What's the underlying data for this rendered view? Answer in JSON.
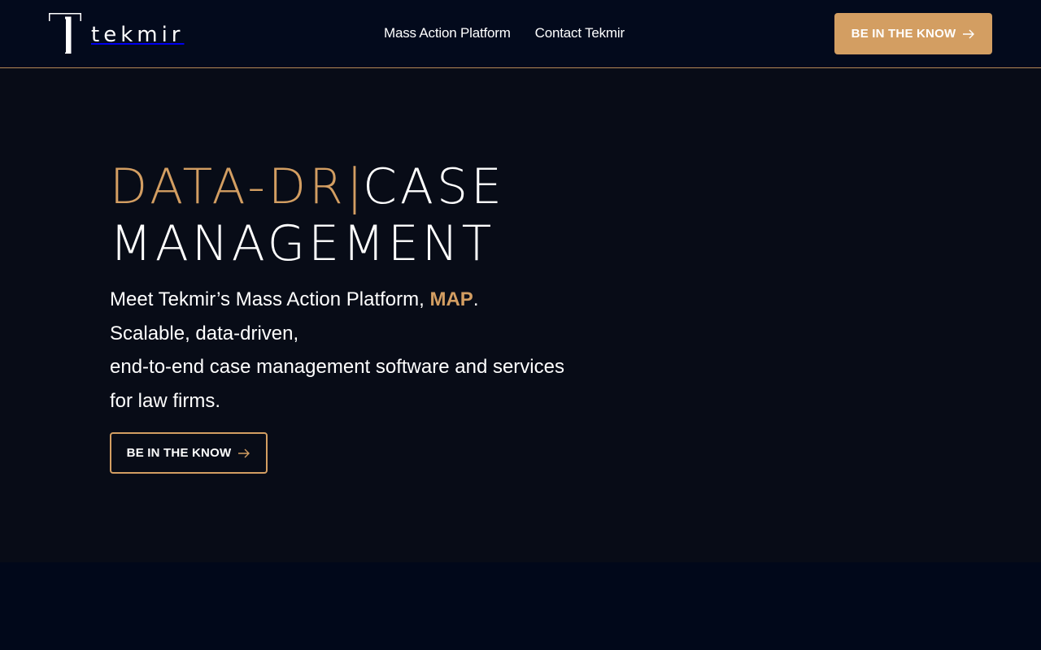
{
  "brand": {
    "logo_text": "tekmir",
    "logo_icon": "tekmir-t-mark-icon"
  },
  "nav": {
    "items": [
      "Mass Action Platform",
      "Contact Tekmir"
    ]
  },
  "header_cta": {
    "label": "BE IN THE KNOW",
    "icon": "arrow-right-icon"
  },
  "hero": {
    "headline_typed": "DATA-DR",
    "headline_cursor": "|",
    "headline_rest_1": "CASE",
    "headline_rest_2": "MANAGEMENT",
    "sub_prefix": "Meet Tekmir’s Mass Action Platform, ",
    "sub_highlight": "MAP",
    "sub_suffix": ".",
    "sub_line_2": "Scalable, data-driven,",
    "sub_line_3": "end-to-end case management software and services",
    "sub_line_4": "for law firms.",
    "cta_label": "BE IN THE KNOW",
    "cta_icon": "arrow-right-icon"
  },
  "colors": {
    "accent": "#d39e62",
    "header_bg": "#030a1c",
    "hero_bg": "#080c17",
    "page_bg": "#01081a"
  }
}
